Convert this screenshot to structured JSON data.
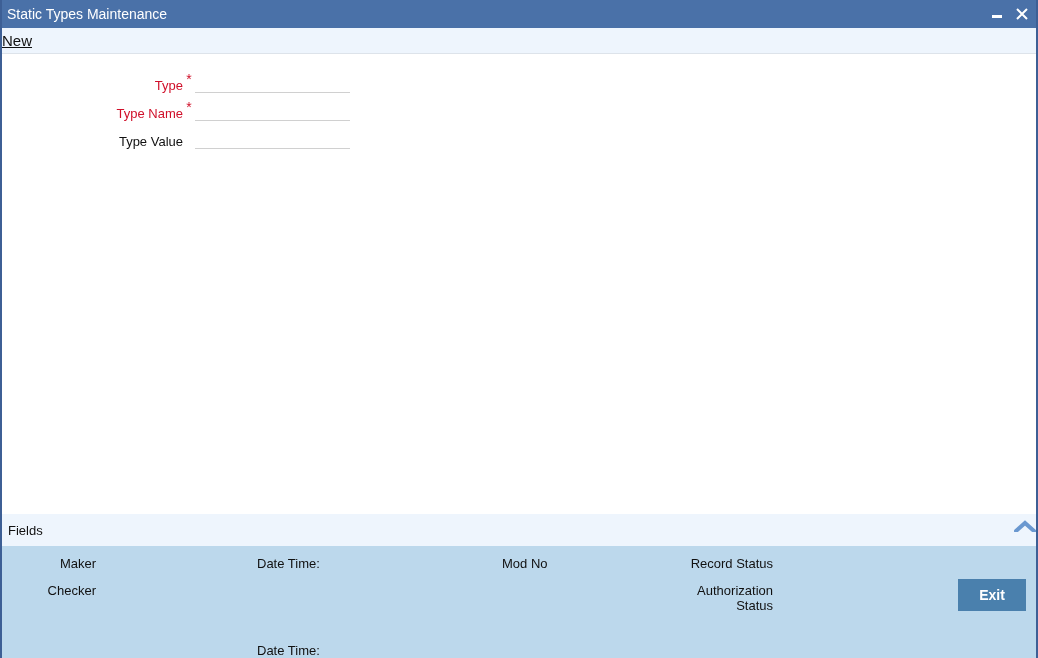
{
  "window": {
    "title": "Static Types Maintenance"
  },
  "toolbar": {
    "items": [
      "New"
    ]
  },
  "form": {
    "fields": [
      {
        "label": "Type",
        "required": true,
        "required_mark": "*"
      },
      {
        "label": "Type Name",
        "required": true,
        "required_mark": "*"
      },
      {
        "label": "Type Value",
        "required": false
      }
    ]
  },
  "fields_bar": {
    "label": "Fields"
  },
  "audit": {
    "maker": "Maker",
    "maker_date_time": "Date Time:",
    "mod_no": "Mod No",
    "record_status": "Record Status",
    "checker": "Checker",
    "checker_date_time": "Date Time:",
    "authorization_status": "Authorization Status"
  },
  "buttons": [
    "Exit"
  ]
}
